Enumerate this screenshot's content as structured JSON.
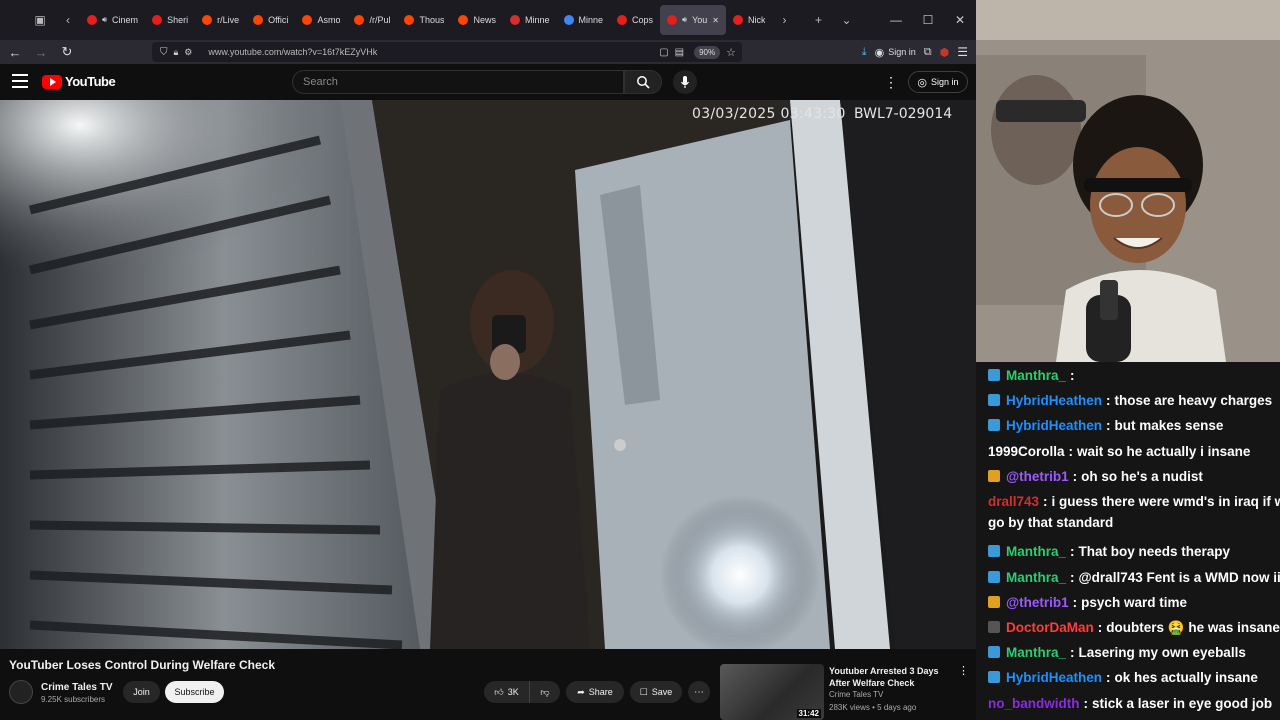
{
  "browser": {
    "tabs": [
      {
        "label": "Cinem",
        "color": "#e61e1e"
      },
      {
        "label": "Sheri",
        "color": "#e61e1e"
      },
      {
        "label": "r/Live",
        "color": "#ff4500"
      },
      {
        "label": "Offici",
        "color": "#ff4500"
      },
      {
        "label": "Asmo",
        "color": "#ff4500"
      },
      {
        "label": "/r/Pul",
        "color": "#ff4500"
      },
      {
        "label": "Thous",
        "color": "#ff4500"
      },
      {
        "label": "News",
        "color": "#ff4500"
      },
      {
        "label": "Minne",
        "color": "#d62d2d"
      },
      {
        "label": "Minne",
        "color": "#4285f4"
      },
      {
        "label": "Cops",
        "color": "#e61e1e"
      },
      {
        "label": "You",
        "color": "#e61e1e"
      },
      {
        "label": "Nick",
        "color": "#e61e1e"
      }
    ],
    "url": "www.youtube.com/watch?v=16t7kEZyVHk",
    "zoom": "90%",
    "signin_label": "Sign in"
  },
  "youtube": {
    "logo_text": "YouTube",
    "search_placeholder": "Search",
    "signin_label": "Sign in",
    "video": {
      "timestamp_overlay": "03/03/2025 03:43:30",
      "camera_id_overlay": "BWL7-029014",
      "title": "YouTuber Loses Control During Welfare Check",
      "channel": "Crime Tales TV",
      "subscribers": "9.25K subscribers",
      "join_label": "Join",
      "subscribe_label": "Subscribe",
      "likes": "3K",
      "share_label": "Share",
      "save_label": "Save"
    },
    "recommended": {
      "title": "Youtuber Arrested 3 Days After Welfare Check",
      "channel": "Crime Tales TV",
      "meta": "283K views • 5 days ago",
      "duration": "31:42"
    }
  },
  "stream_chat": {
    "messages": [
      {
        "user": "Manthra_",
        "user_color": "#2ecc71",
        "badge": "#3a9ad9",
        "text": ""
      },
      {
        "user": "HybridHeathen",
        "user_color": "#1e90ff",
        "badge": "#3a9ad9",
        "text": "those are heavy charges"
      },
      {
        "user": "HybridHeathen",
        "user_color": "#1e90ff",
        "badge": "#3a9ad9",
        "text": "but makes sense"
      },
      {
        "user": "1999Corolla",
        "user_color": "#ffffff",
        "badge": "",
        "text": "wait so he actually i insane"
      },
      {
        "user": "@thetrib1",
        "user_color": "#9b59ff",
        "badge": "#e0a020",
        "text": "oh so he's a nudist"
      },
      {
        "user": "drall743",
        "user_color": "#d03030",
        "badge": "",
        "text": "i guess there were wmd's in iraq if w"
      },
      {
        "user": "",
        "user_color": "#ffffff",
        "badge": "",
        "text": "go by that standard"
      },
      {
        "user": "Manthra_",
        "user_color": "#2ecc71",
        "badge": "#3a9ad9",
        "text": "That boy needs therapy"
      },
      {
        "user": "Manthra_",
        "user_color": "#2ecc71",
        "badge": "#3a9ad9",
        "text": "@drall743 Fent is a WMD now iir"
      },
      {
        "user": "@thetrib1",
        "user_color": "#9b59ff",
        "badge": "#e0a020",
        "text": "psych ward time"
      },
      {
        "user": "DoctorDaMan",
        "user_color": "#ff3c3c",
        "badge": "#555555",
        "text": "doubters 🤮 he was insane"
      },
      {
        "user": "Manthra_",
        "user_color": "#2ecc71",
        "badge": "#3a9ad9",
        "text": "Lasering my own eyeballs"
      },
      {
        "user": "HybridHeathen",
        "user_color": "#1e90ff",
        "badge": "#3a9ad9",
        "text": "ok hes actually insane"
      },
      {
        "user": "no_bandwidth",
        "user_color": "#8a2be2",
        "badge": "",
        "text": "stick a laser in eye good job"
      }
    ]
  }
}
